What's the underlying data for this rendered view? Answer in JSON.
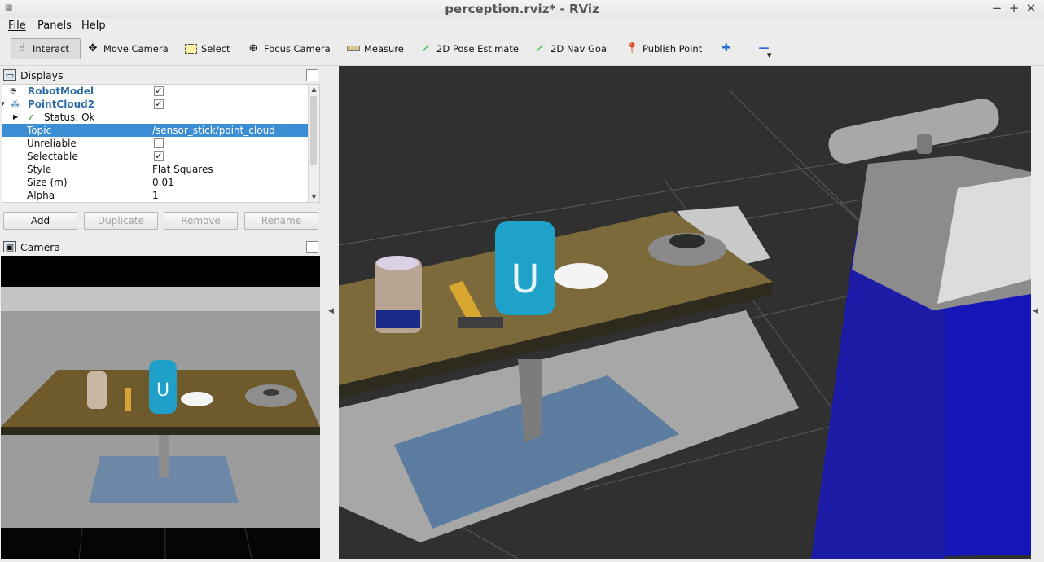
{
  "window": {
    "title": "perception.rviz* - RViz",
    "minimize_glyph": "−",
    "maximize_glyph": "+",
    "close_glyph": "✕"
  },
  "menu": [
    "File",
    "Panels",
    "Help"
  ],
  "toolbar": {
    "tools": [
      {
        "label": "Interact",
        "icon": "hand-icon",
        "active": true
      },
      {
        "label": "Move Camera",
        "icon": "move-icon"
      },
      {
        "label": "Select",
        "icon": "select-icon"
      },
      {
        "label": "Focus Camera",
        "icon": "focus-icon"
      },
      {
        "label": "Measure",
        "icon": "ruler-icon"
      },
      {
        "label": "2D Pose Estimate",
        "icon": "green-arrow-icon"
      },
      {
        "label": "2D Nav Goal",
        "icon": "green-arrow-icon"
      },
      {
        "label": "Publish Point",
        "icon": "map-pin-icon"
      }
    ],
    "add_glyph": "✚",
    "remove_glyph": "—"
  },
  "displays_panel": {
    "title": "Displays",
    "rows": [
      {
        "label": "RobotModel",
        "checked": true,
        "type": "display"
      },
      {
        "label": "PointCloud2",
        "checked": true,
        "type": "display"
      },
      {
        "label": "Status: Ok",
        "type": "status"
      },
      {
        "label": "Topic",
        "value": "/sensor_stick/point_cloud",
        "selected": true
      },
      {
        "label": "Unreliable",
        "checked": false
      },
      {
        "label": "Selectable",
        "checked": true
      },
      {
        "label": "Style",
        "value": "Flat Squares"
      },
      {
        "label": "Size (m)",
        "value": "0.01"
      },
      {
        "label": "Alpha",
        "value": "1"
      }
    ],
    "buttons": {
      "add": "Add",
      "duplicate": "Duplicate",
      "remove": "Remove",
      "rename": "Rename"
    }
  },
  "camera_panel": {
    "title": "Camera"
  },
  "colors": {
    "selection": "#3b8dd4",
    "display_label": "#2e6da4",
    "grid_bg": "#303030",
    "pillar_blue": "#1616b8"
  }
}
